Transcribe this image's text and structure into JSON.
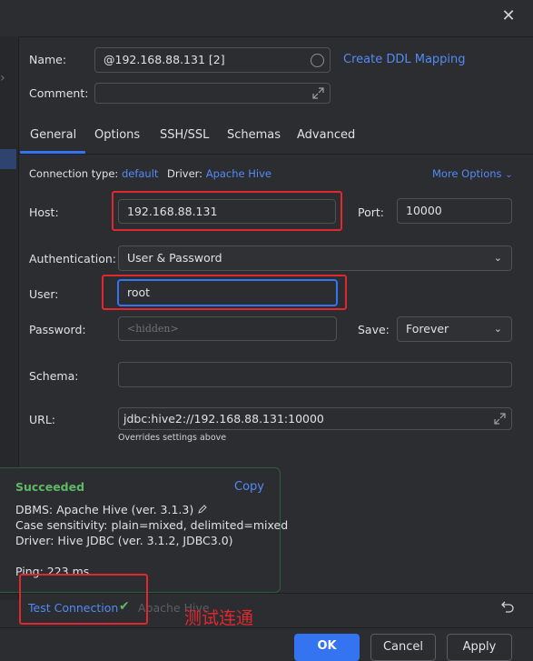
{
  "window": {
    "close_glyph": "✕"
  },
  "form": {
    "name_label": "Name:",
    "name_value": "@192.168.88.131 [2]",
    "create_ddl_link": "Create DDL Mapping",
    "comment_label": "Comment:",
    "comment_value": ""
  },
  "tabs": [
    {
      "label": "General",
      "active": true
    },
    {
      "label": "Options"
    },
    {
      "label": "SSH/SSL"
    },
    {
      "label": "Schemas"
    },
    {
      "label": "Advanced"
    }
  ],
  "general": {
    "connection_type_label": "Connection type:",
    "connection_type_value": "default",
    "driver_label": "Driver:",
    "driver_value": "Apache Hive",
    "more_options": "More Options",
    "host_label": "Host:",
    "host_value": "192.168.88.131",
    "port_label": "Port:",
    "port_value": "10000",
    "auth_label": "Authentication:",
    "auth_value": "User & Password",
    "user_label": "User:",
    "user_value": "root",
    "password_label": "Password:",
    "password_placeholder": "<hidden>",
    "save_label": "Save:",
    "save_value": "Forever",
    "schema_label": "Schema:",
    "schema_value": "",
    "url_label": "URL:",
    "url_value": "jdbc:hive2://192.168.88.131:10000",
    "url_hint": "Overrides settings above"
  },
  "popup": {
    "status": "Succeeded",
    "copy_label": "Copy",
    "dbms_line": "DBMS: Apache Hive (ver. 3.1.3)",
    "case_line": "Case sensitivity: plain=mixed, delimited=mixed",
    "driver_line": "Driver: Hive JDBC (ver. 3.1.2, JDBC3.0)",
    "ping_line": "Ping: 223 ms"
  },
  "bottom": {
    "test_connection": "Test Connection",
    "test_driver_ghost": "Apache Hive",
    "annotation": "测试连通",
    "ok": "OK",
    "cancel": "Cancel",
    "apply": "Apply"
  },
  "colors": {
    "accent": "#3574f0",
    "link": "#548af7",
    "success": "#5fb865",
    "highlight_box": "#e0282e"
  }
}
